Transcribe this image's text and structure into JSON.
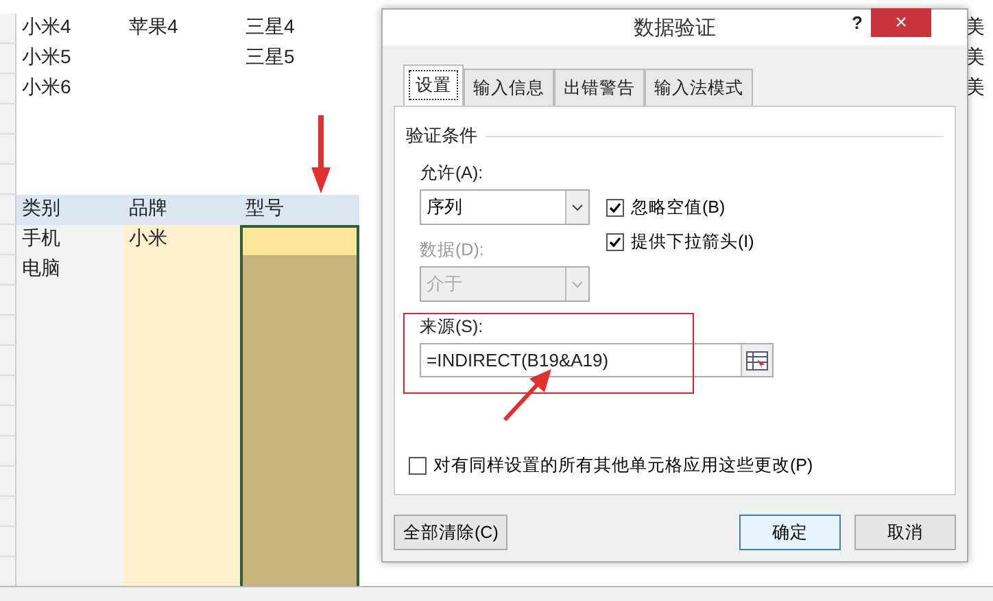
{
  "sheet": {
    "rows": [
      {
        "a": "小米4",
        "b": "苹果4",
        "c": "三星4",
        "right": "美"
      },
      {
        "a": "小米5",
        "c": "三星5",
        "right": "美"
      },
      {
        "a": "小米6",
        "right": "美"
      }
    ]
  },
  "table": {
    "columns": [
      "类别",
      "品牌",
      "型号"
    ],
    "rows": [
      {
        "category": "手机",
        "brand": "小米",
        "active": true
      },
      {
        "category": "电脑",
        "active": false
      }
    ]
  },
  "dialog": {
    "title": "数据验证",
    "help": "?",
    "close": "×",
    "tabs": [
      {
        "label": "设置",
        "selected": true
      },
      {
        "label": "输入信息",
        "selected": false
      },
      {
        "label": "出错警告",
        "selected": false
      },
      {
        "label": "输入法模式",
        "selected": false
      }
    ],
    "group_title": "验证条件",
    "allow": {
      "label": "允许(A):",
      "value": "序列"
    },
    "data": {
      "label": "数据(D):",
      "value": "介于",
      "disabled": true
    },
    "checkboxes": [
      {
        "label": "忽略空值(B)",
        "checked": true
      },
      {
        "label": "提供下拉箭头(I)",
        "checked": true
      }
    ],
    "source": {
      "label": "来源(S):",
      "value": "=INDIRECT(B19&A19)"
    },
    "apply_all": {
      "label": "对有同样设置的所有其他单元格应用这些更改(P)",
      "checked": false
    },
    "buttons": [
      {
        "label": "全部清除(C)",
        "kind": "clear"
      },
      {
        "label": "确定",
        "kind": "ok"
      },
      {
        "label": "取消",
        "kind": "cancel"
      }
    ]
  }
}
